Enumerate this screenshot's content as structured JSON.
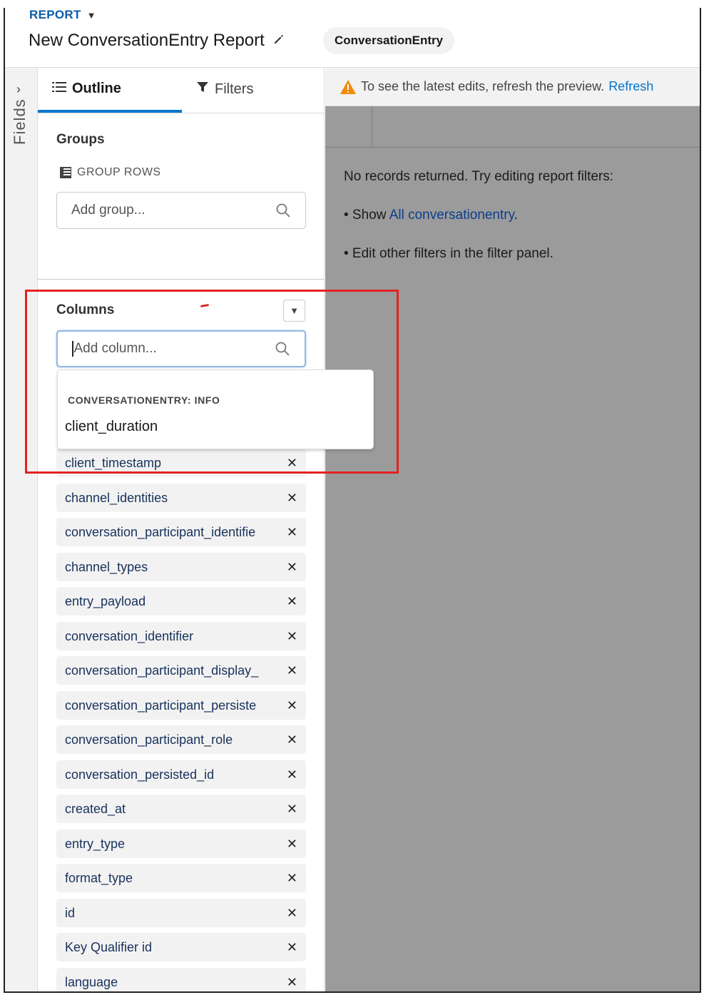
{
  "header": {
    "report_label": "REPORT",
    "title": "New ConversationEntry Report",
    "report_type": "ConversationEntry"
  },
  "rail": {
    "fields_label": "Fields"
  },
  "tabs": {
    "outline": "Outline",
    "filters": "Filters"
  },
  "groups": {
    "title": "Groups",
    "group_rows_label": "GROUP ROWS",
    "placeholder": "Add group..."
  },
  "columns": {
    "title": "Columns",
    "search_value": "Add column...",
    "dropdown": {
      "section": "CONVERSATIONENTRY: INFO",
      "option": "client_duration"
    },
    "items": [
      "client_timestamp",
      "channel_identities",
      "conversation_participant_identifie",
      "channel_types",
      "entry_payload",
      "conversation_identifier",
      "conversation_participant_display_",
      "conversation_participant_persiste",
      "conversation_participant_role",
      "conversation_persisted_id",
      "created_at",
      "entry_type",
      "format_type",
      "id",
      "Key Qualifier id",
      "language"
    ],
    "remove_glyph": "✕"
  },
  "preview": {
    "notice_text": "To see the latest edits, refresh the preview.",
    "refresh_label": "Refresh",
    "no_records": "No records returned. Try editing report filters:",
    "bullet1_prefix": "• Show ",
    "bullet1_link": "All conversationentry",
    "bullet1_suffix": ".",
    "bullet2": "• Edit other filters in the filter panel."
  },
  "colors": {
    "accent": "#0176d3",
    "highlight": "#e32222",
    "preview_bg": "#9b9b9b"
  }
}
